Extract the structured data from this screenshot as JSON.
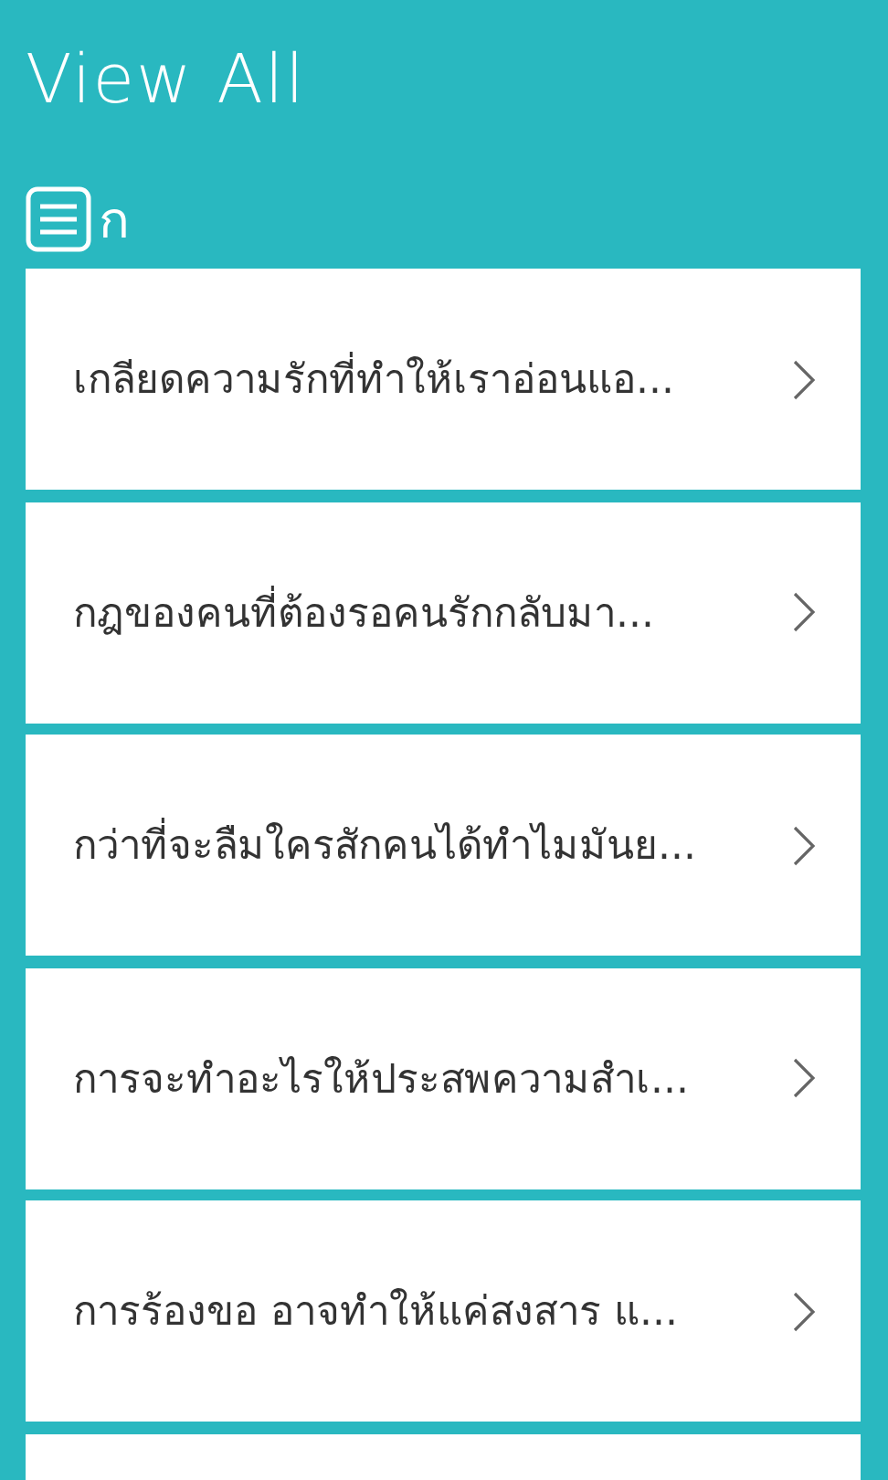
{
  "header": {
    "title": "View All"
  },
  "group": {
    "label": "ก"
  },
  "items": [
    {
      "title": "เกลียดความรักที่ทำให้เราอ่อนแอ..."
    },
    {
      "title": "กฎของคนที่ต้องรอคนรักกลับมา..."
    },
    {
      "title": "กว่าที่จะลืมใครสักคนได้ทำไมมันย..."
    },
    {
      "title": "การจะทำอะไรให้ประสพความสำเ..."
    },
    {
      "title": "การร้องขอ อาจทำให้แค่สงสาร แ..."
    }
  ],
  "more_below": true
}
